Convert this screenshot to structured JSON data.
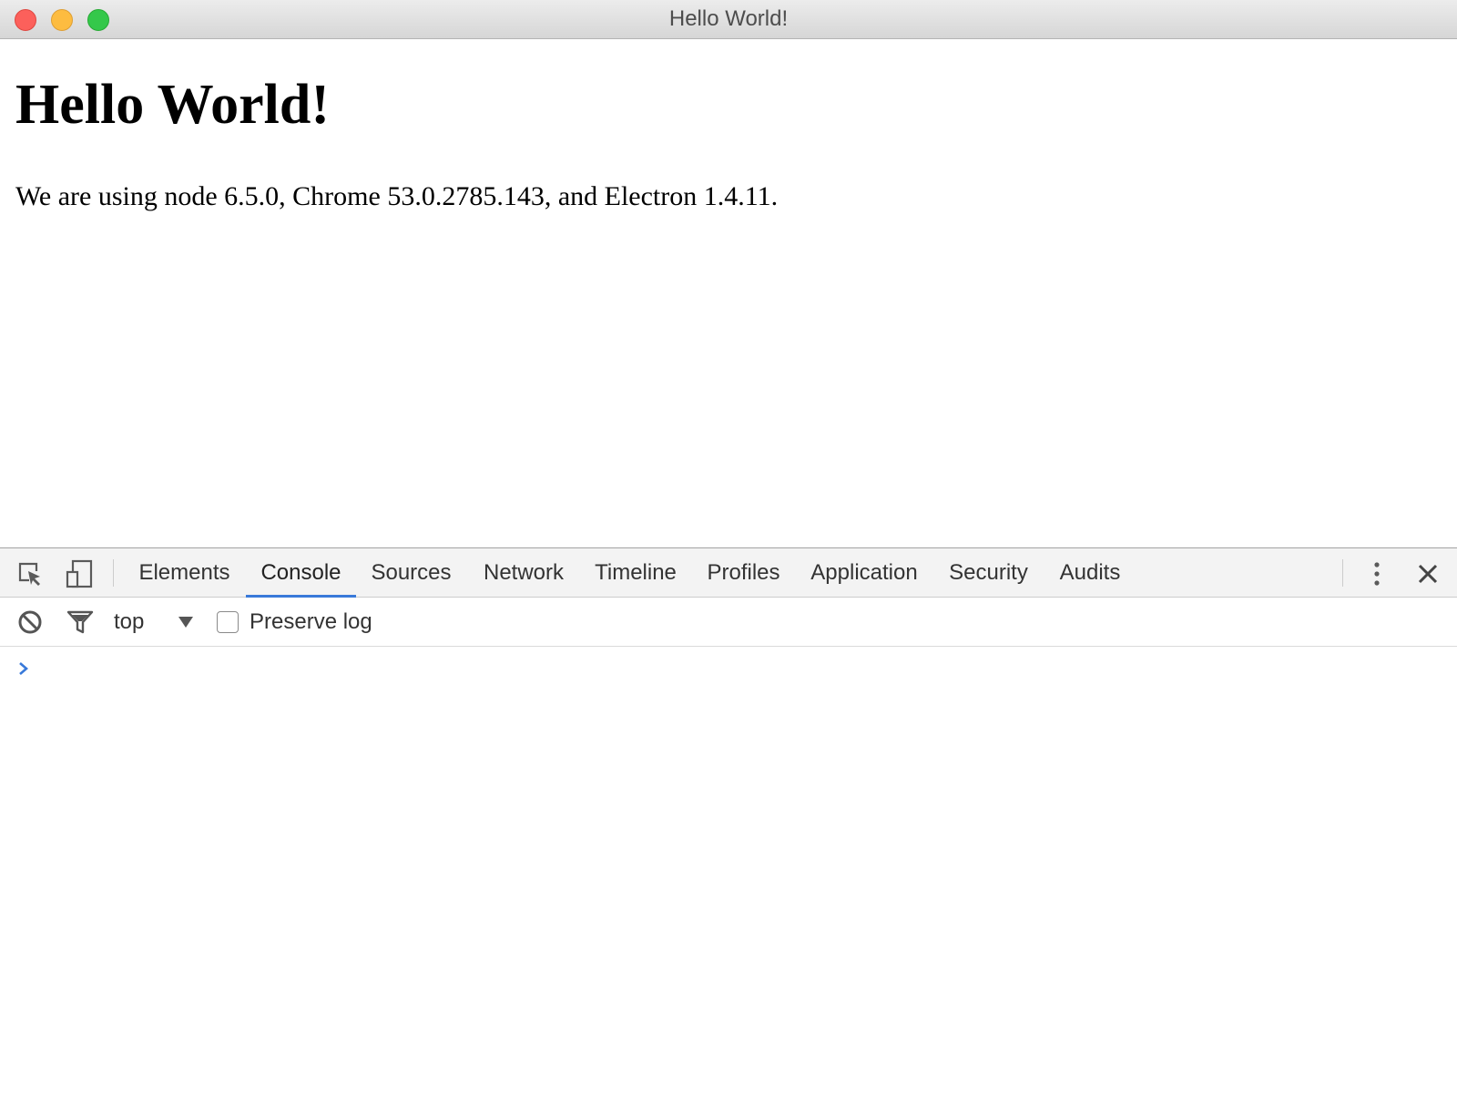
{
  "window": {
    "title": "Hello World!"
  },
  "page": {
    "heading": "Hello World!",
    "text": "We are using node 6.5.0, Chrome 53.0.2785.143, and Electron 1.4.11."
  },
  "devtools": {
    "tabs": [
      {
        "label": "Elements",
        "active": false
      },
      {
        "label": "Console",
        "active": true
      },
      {
        "label": "Sources",
        "active": false
      },
      {
        "label": "Network",
        "active": false
      },
      {
        "label": "Timeline",
        "active": false
      },
      {
        "label": "Profiles",
        "active": false
      },
      {
        "label": "Application",
        "active": false
      },
      {
        "label": "Security",
        "active": false
      },
      {
        "label": "Audits",
        "active": false
      }
    ],
    "icons": {
      "inspect": "inspect-element-icon",
      "device": "device-toolbar-icon",
      "more": "more-vertical-icon",
      "close": "close-icon",
      "clear": "clear-console-icon",
      "filter": "filter-icon",
      "dropdown": "dropdown-arrow-icon",
      "prompt": "console-prompt-icon"
    },
    "console": {
      "context": "top",
      "preserve_log_label": "Preserve log",
      "preserve_log_checked": false
    },
    "accent_color": "#3879d9"
  }
}
